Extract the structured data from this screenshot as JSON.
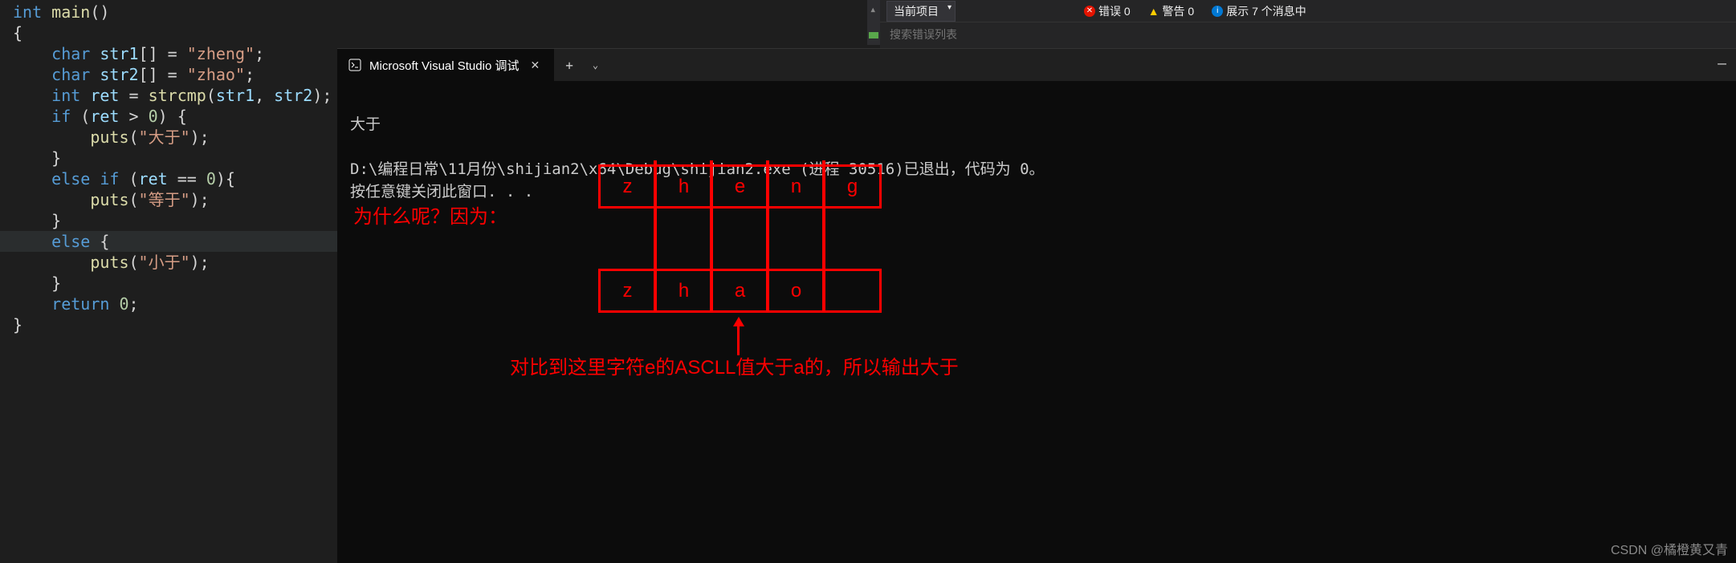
{
  "code": {
    "l1_kw": "int",
    "l1_fn": " main",
    "l1_p": "()",
    "l2": "{",
    "l3_kw": "    char",
    "l3_var": " str1",
    "l3_p1": "[] = ",
    "l3_str": "\"zheng\"",
    "l3_p2": ";",
    "l4_kw": "    char",
    "l4_var": " str2",
    "l4_p1": "[] = ",
    "l4_str": "\"zhao\"",
    "l4_p2": ";",
    "l5_kw": "    int",
    "l5_var": " ret",
    "l5_p1": " = ",
    "l5_fn": "strcmp",
    "l5_p2": "(",
    "l5_a1": "str1",
    "l5_p3": ", ",
    "l5_a2": "str2",
    "l5_p4": ");",
    "l6_kw": "    if",
    "l6_p1": " (",
    "l6_var": "ret",
    "l6_p2": " > ",
    "l6_num": "0",
    "l6_p3": ") {",
    "l7_fn": "        puts",
    "l7_p1": "(",
    "l7_str": "\"大于\"",
    "l7_p2": ");",
    "l8": "    }",
    "l9_kw": "    else if",
    "l9_p1": " (",
    "l9_var": "ret",
    "l9_p2": " == ",
    "l9_num": "0",
    "l9_p3": "){",
    "l10_fn": "        puts",
    "l10_p1": "(",
    "l10_str": "\"等于\"",
    "l10_p2": ");",
    "l11": "    }",
    "l12_kw": "    else",
    "l12_p": " {",
    "l13_fn": "        puts",
    "l13_p1": "(",
    "l13_str": "\"小于\"",
    "l13_p2": ");",
    "l14": "    }",
    "l15_kw": "    return",
    "l15_p1": " ",
    "l15_num": "0",
    "l15_p2": ";",
    "l16": "}"
  },
  "terminal": {
    "tab_title": "Microsoft Visual Studio 调试",
    "out1": "大于",
    "out2": "",
    "out3": "D:\\编程日常\\11月份\\shijian2\\x64\\Debug\\shijian2.exe (进程 30516)已退出，代码为 0。",
    "out4": "按任意键关闭此窗口. . ."
  },
  "annotations": {
    "why": "为什么呢？因为：",
    "row1": [
      "z",
      "h",
      "e",
      "n",
      "g"
    ],
    "row2": [
      "z",
      "h",
      "a",
      "o",
      ""
    ],
    "explain": "对比到这里字符e的ASCLL值大于a的，所以输出大于"
  },
  "status": {
    "dropdown": "当前项目",
    "errors": "错误 0",
    "warnings": "警告 0",
    "messages": "展示 7 个消息中",
    "search_placeholder": "搜索错误列表"
  },
  "watermark": "CSDN @橘橙黄又青"
}
